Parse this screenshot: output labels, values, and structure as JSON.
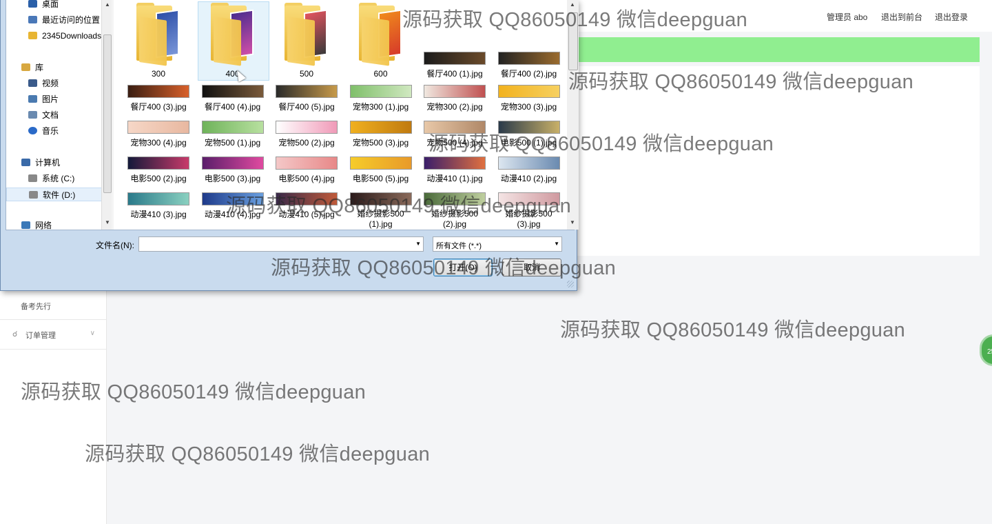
{
  "header": {
    "admin_label": "管理员 abo",
    "front_link": "退出到前台",
    "logout_link": "退出登录"
  },
  "sidebar": {
    "item_partial": "备考先行",
    "item_orders": "订单管理"
  },
  "floating_badge": "25",
  "dialog": {
    "nav": [
      {
        "label": "桌面",
        "icon": "desktop-icon"
      },
      {
        "label": "最近访问的位置",
        "icon": "recent-places-icon"
      },
      {
        "label": "2345Downloads",
        "icon": "folder-icon"
      },
      {
        "label": "库",
        "icon": "library-icon"
      },
      {
        "label": "视频",
        "icon": "video-icon"
      },
      {
        "label": "图片",
        "icon": "pictures-icon"
      },
      {
        "label": "文档",
        "icon": "documents-icon"
      },
      {
        "label": "音乐",
        "icon": "music-icon"
      },
      {
        "label": "计算机",
        "icon": "computer-icon"
      },
      {
        "label": "系统 (C:)",
        "icon": "drive-icon"
      },
      {
        "label": "软件 (D:)",
        "icon": "drive-icon"
      },
      {
        "label": "网络",
        "icon": "network-icon"
      }
    ],
    "files": [
      {
        "name": "300",
        "kind": "folder",
        "colors": [
          "#2d4fa8",
          "#7a96d8"
        ]
      },
      {
        "name": "400",
        "kind": "folder",
        "colors": [
          "#4b2c8e",
          "#d04fa8"
        ]
      },
      {
        "name": "500",
        "kind": "folder",
        "colors": [
          "#e2535f",
          "#3a3a3a"
        ]
      },
      {
        "name": "600",
        "kind": "folder",
        "colors": [
          "#f08a1c",
          "#d63a2a"
        ]
      },
      {
        "name": "餐厅400 (1).jpg",
        "kind": "image",
        "colors": [
          "#1b1b1b",
          "#6a4a2a"
        ]
      },
      {
        "name": "餐厅400 (2).jpg",
        "kind": "image",
        "colors": [
          "#222222",
          "#9a6b2e"
        ]
      },
      {
        "name": "餐厅400 (3).jpg",
        "kind": "image",
        "colors": [
          "#3a1e12",
          "#d8602a"
        ]
      },
      {
        "name": "餐厅400 (4).jpg",
        "kind": "image",
        "colors": [
          "#111111",
          "#7a5a3a"
        ]
      },
      {
        "name": "餐厅400 (5).jpg",
        "kind": "image",
        "colors": [
          "#2a2a2a",
          "#c79a4a"
        ]
      },
      {
        "name": "宠物300 (1).jpg",
        "kind": "image",
        "colors": [
          "#7fbf6a",
          "#d0e8c0"
        ]
      },
      {
        "name": "宠物300 (2).jpg",
        "kind": "image",
        "colors": [
          "#f0e8e0",
          "#c05050"
        ]
      },
      {
        "name": "宠物300 (3).jpg",
        "kind": "image",
        "colors": [
          "#f2b21e",
          "#f6d060"
        ]
      },
      {
        "name": "宠物300 (4).jpg",
        "kind": "image",
        "colors": [
          "#f6d7c7",
          "#e8b8a0"
        ]
      },
      {
        "name": "宠物500 (1).jpg",
        "kind": "image",
        "colors": [
          "#6fb35a",
          "#b8e0a0"
        ]
      },
      {
        "name": "宠物500 (2).jpg",
        "kind": "image",
        "colors": [
          "#ffffff",
          "#f09ab8"
        ]
      },
      {
        "name": "宠物500 (3).jpg",
        "kind": "image",
        "colors": [
          "#f0b020",
          "#c07a10"
        ]
      },
      {
        "name": "宠物500 (4).jpg",
        "kind": "image",
        "colors": [
          "#e8c8a8",
          "#b08868"
        ]
      },
      {
        "name": "电影500 (1).jpg",
        "kind": "image",
        "colors": [
          "#2a3a4a",
          "#c8b068"
        ]
      },
      {
        "name": "电影500 (2).jpg",
        "kind": "image",
        "colors": [
          "#141a3a",
          "#c83a6a"
        ]
      },
      {
        "name": "电影500 (3).jpg",
        "kind": "image",
        "colors": [
          "#5a1e6a",
          "#e04aa0"
        ]
      },
      {
        "name": "电影500 (4).jpg",
        "kind": "image",
        "colors": [
          "#f4c8c8",
          "#e88888"
        ]
      },
      {
        "name": "电影500 (5).jpg",
        "kind": "image",
        "colors": [
          "#f6cc2a",
          "#e89a2a"
        ]
      },
      {
        "name": "动漫410 (1).jpg",
        "kind": "image",
        "colors": [
          "#3a1e6a",
          "#e07040"
        ]
      },
      {
        "name": "动漫410 (2).jpg",
        "kind": "image",
        "colors": [
          "#dce6f0",
          "#6a8ab0"
        ]
      },
      {
        "name": "动漫410 (3).jpg",
        "kind": "image",
        "colors": [
          "#2a7a8a",
          "#8ad0c0"
        ]
      },
      {
        "name": "动漫410 (4).jpg",
        "kind": "image",
        "colors": [
          "#1e3a8a",
          "#6aa0e0"
        ]
      },
      {
        "name": "动漫410 (5).jpg",
        "kind": "image",
        "colors": [
          "#3a2a4a",
          "#c05a3a"
        ]
      },
      {
        "name": "婚纱摄影500 (1).jpg",
        "kind": "image",
        "colors": [
          "#2a1a1a",
          "#8a6a5a"
        ]
      },
      {
        "name": "婚纱摄影500 (2).jpg",
        "kind": "image",
        "colors": [
          "#4a6a3a",
          "#c0d0a0"
        ]
      },
      {
        "name": "婚纱摄影500 (3).jpg",
        "kind": "image",
        "colors": [
          "#f4e4e4",
          "#d09aa0"
        ]
      }
    ],
    "filename_label": "文件名(N):",
    "filename_value": "",
    "filetype_value": "所有文件 (*.*)",
    "open_button": "打开(O)",
    "cancel_button": "取消"
  },
  "watermarks": [
    "源码获取 QQ86050149 微信deepguan",
    "源码获取 QQ86050149 微信deepguan",
    "源码获取 QQ86050149 微信deepguan",
    "源码获取 QQ86050149 微信deepguan",
    "源码获取 QQ86050149 微信deepguan",
    "源码获取 QQ86050149 微信deepguan",
    "源码获取 QQ86050149 微信deepguan",
    "源码获取 QQ86050149 微信deepguan"
  ]
}
